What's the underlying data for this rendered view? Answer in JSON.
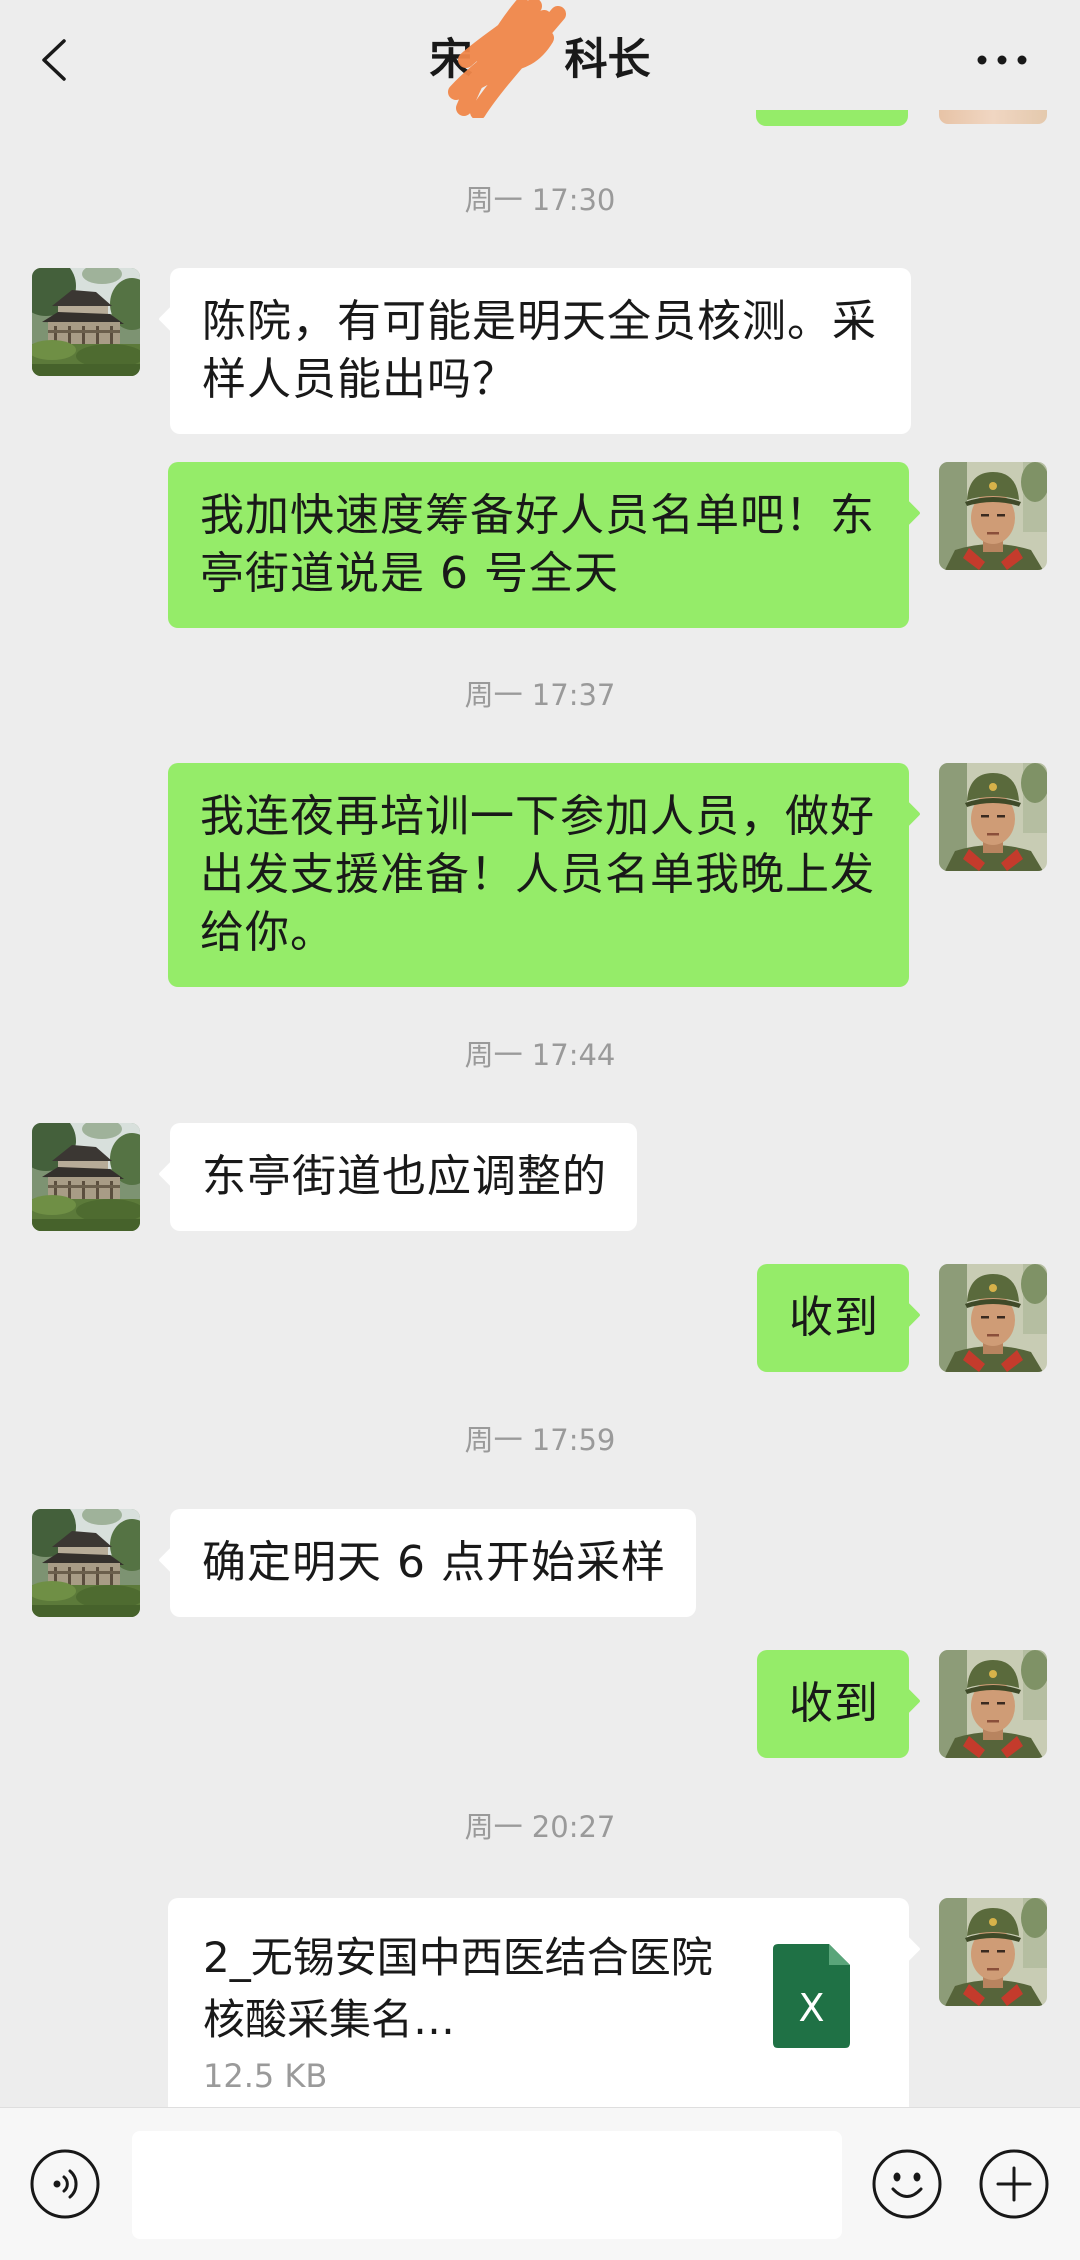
{
  "header": {
    "title_prefix": "宋",
    "title_suffix": "科长",
    "back_icon": "chevron-left-icon",
    "more_icon": "more-dots-icon"
  },
  "timestamps": [
    "周一 17:30",
    "周一 17:37",
    "周一 17:44",
    "周一 17:59",
    "周一 20:27"
  ],
  "messages": [
    {
      "text": "陈院，有可能是明天全员核测。采样人员能出吗？"
    },
    {
      "text": "我加快速度筹备好人员名单吧！东亭街道说是 6 号全天"
    },
    {
      "text": "我连夜再培训一下参加人员，做好出发支援准备！人员名单我晚上发给你。"
    },
    {
      "text": "东亭街道也应调整的"
    },
    {
      "text": "收到"
    },
    {
      "text": "确定明天 6 点开始采样"
    },
    {
      "text": "收到"
    },
    {
      "file_name": "2_无锡安国中西医结合医院核酸采集名…",
      "file_size": "12.5 KB",
      "file_icon": "excel-file-icon",
      "file_icon_letter": "X"
    }
  ],
  "input": {
    "value": "",
    "placeholder": ""
  },
  "toolbar": {
    "voice_icon": "voice-icon",
    "emoji_icon": "emoji-icon",
    "plus_icon": "plus-icon"
  },
  "colors": {
    "background": "#ededed",
    "bubble_me": "#95ec69",
    "bubble_contact": "#ffffff",
    "text": "#191919",
    "timestamp": "#9a9a9a",
    "redaction_scribble": "#f0874a",
    "excel_icon": "#1f7145"
  }
}
